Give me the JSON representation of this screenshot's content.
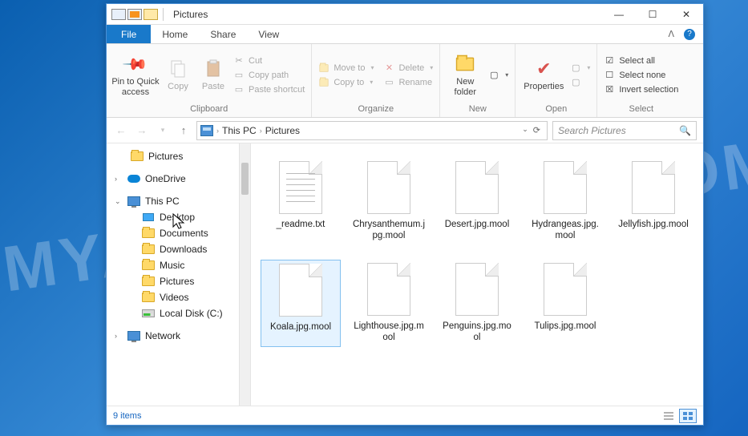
{
  "watermark": "MYANTISPYWARE.COM",
  "titlebar": {
    "title": "Pictures"
  },
  "win": {
    "min": "—",
    "max": "☐",
    "close": "✕"
  },
  "tabs": {
    "file": "File",
    "home": "Home",
    "share": "Share",
    "view": "View"
  },
  "ribbon": {
    "clipboard": {
      "label": "Clipboard",
      "pin": "Pin to Quick access",
      "copy": "Copy",
      "paste": "Paste",
      "cut": "Cut",
      "copypath": "Copy path",
      "pasteshort": "Paste shortcut"
    },
    "organize": {
      "label": "Organize",
      "moveto": "Move to",
      "copyto": "Copy to",
      "delete": "Delete",
      "rename": "Rename"
    },
    "new": {
      "label": "New",
      "newfolder": "New folder"
    },
    "open": {
      "label": "Open",
      "properties": "Properties"
    },
    "select": {
      "label": "Select",
      "all": "Select all",
      "none": "Select none",
      "invert": "Invert selection"
    }
  },
  "address": {
    "thispc": "This PC",
    "pictures": "Pictures",
    "search_placeholder": "Search Pictures"
  },
  "sidebar": {
    "pictures": "Pictures",
    "onedrive": "OneDrive",
    "thispc": "This PC",
    "desktop": "Desktop",
    "documents": "Documents",
    "downloads": "Downloads",
    "music": "Music",
    "pictures2": "Pictures",
    "videos": "Videos",
    "localdisk": "Local Disk (C:)",
    "network": "Network"
  },
  "files": [
    {
      "name": "_readme.txt",
      "type": "txt",
      "selected": false
    },
    {
      "name": "Chrysanthemum.jpg.mool",
      "type": "blank",
      "selected": false
    },
    {
      "name": "Desert.jpg.mool",
      "type": "blank",
      "selected": false
    },
    {
      "name": "Hydrangeas.jpg.mool",
      "type": "blank",
      "selected": false
    },
    {
      "name": "Jellyfish.jpg.mool",
      "type": "blank",
      "selected": false
    },
    {
      "name": "Koala.jpg.mool",
      "type": "blank",
      "selected": true
    },
    {
      "name": "Lighthouse.jpg.mool",
      "type": "blank",
      "selected": false
    },
    {
      "name": "Penguins.jpg.mool",
      "type": "blank",
      "selected": false
    },
    {
      "name": "Tulips.jpg.mool",
      "type": "blank",
      "selected": false
    }
  ],
  "status": {
    "count": "9 items"
  }
}
